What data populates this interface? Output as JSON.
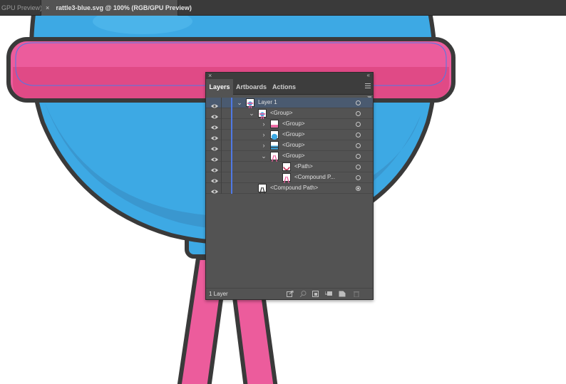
{
  "tabs": {
    "previous": "GPU Preview)",
    "active_close": "×",
    "active_title": "rattle3-blue.svg @ 100% (RGB/GPU Preview)"
  },
  "colors": {
    "rattle_blue": "#3da9e4",
    "rattle_blue_shade": "#3a97cf",
    "band_pink": "#ec5c9c",
    "band_pink_shade": "#e04a86",
    "outline": "#3a3a3a",
    "selection_blue": "#4f79e6"
  },
  "panel": {
    "close_glyph": "×",
    "collapse_glyph": "«",
    "tabs": [
      "Layers",
      "Artboards",
      "Actions"
    ],
    "active_tab": "Layers",
    "rows": [
      {
        "label": "Layer 1",
        "depth": 0,
        "expander": "open",
        "thumb": "rattle-icon",
        "selected": true,
        "target": "empty"
      },
      {
        "label": "<Group>",
        "depth": 1,
        "expander": "open",
        "thumb": "rattle-icon",
        "selected": false,
        "target": "empty"
      },
      {
        "label": "<Group>",
        "depth": 2,
        "expander": "closed",
        "thumb": "band-icon",
        "selected": false,
        "target": "empty"
      },
      {
        "label": "<Group>",
        "depth": 2,
        "expander": "closed",
        "thumb": "ball-icon",
        "selected": false,
        "target": "empty"
      },
      {
        "label": "<Group>",
        "depth": 2,
        "expander": "closed",
        "thumb": "stripe-icon",
        "selected": false,
        "target": "empty"
      },
      {
        "label": "<Group>",
        "depth": 2,
        "expander": "open",
        "thumb": "handle-icon",
        "selected": false,
        "target": "empty"
      },
      {
        "label": "<Path>",
        "depth": 3,
        "expander": "none",
        "thumb": "path-icon",
        "selected": false,
        "target": "empty"
      },
      {
        "label": "<Compound P...",
        "depth": 3,
        "expander": "none",
        "thumb": "handle-icon",
        "selected": false,
        "target": "empty"
      },
      {
        "label": "<Compound Path>",
        "depth": 1,
        "expander": "none",
        "thumb": "handle-outline-icon",
        "selected": false,
        "target": "filled"
      }
    ],
    "footer": {
      "layer_count": "1 Layer",
      "icons": [
        "export-icon",
        "locate-object-icon",
        "make-clipping-mask-icon",
        "new-sublayer-icon",
        "new-layer-icon",
        "delete-icon"
      ]
    }
  }
}
